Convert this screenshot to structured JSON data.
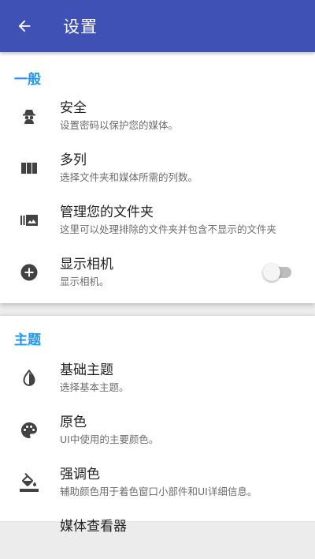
{
  "appbar": {
    "title": "设置"
  },
  "general": {
    "header": "一般",
    "items": [
      {
        "title": "安全",
        "subtitle": "设置密码以保护您的媒体。",
        "icon": "incognito-icon"
      },
      {
        "title": "多列",
        "subtitle": "选择文件夹和媒体所需的列数。",
        "icon": "columns-icon"
      },
      {
        "title": "管理您的文件夹",
        "subtitle": "这里可以处理排除的文件夹并包含不显示的文件夹",
        "icon": "folder-manage-icon"
      },
      {
        "title": "显示相机",
        "subtitle": "显示相机。",
        "icon": "add-circle-icon",
        "toggle": false
      }
    ]
  },
  "theme": {
    "header": "主题",
    "items": [
      {
        "title": "基础主题",
        "subtitle": "选择基本主题。",
        "icon": "invert-colors-icon"
      },
      {
        "title": "原色",
        "subtitle": "UI中使用的主要颜色。",
        "icon": "palette-icon"
      },
      {
        "title": "强调色",
        "subtitle": "辅助颜色用于着色窗口小部件和UI详细信息。",
        "icon": "format-color-fill-icon"
      },
      {
        "title": "媒体查看器",
        "subtitle": "",
        "icon": ""
      }
    ]
  },
  "colors": {
    "primary": "#3f51b5",
    "accent": "#2196f3",
    "icon": "#424242"
  }
}
